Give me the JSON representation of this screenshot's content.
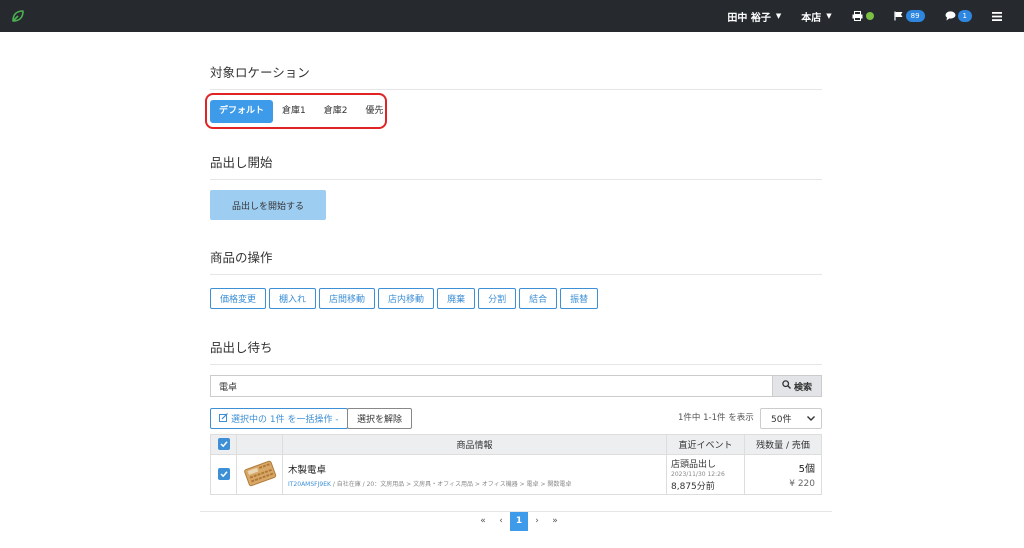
{
  "navbar": {
    "logo_icon": "leaf-icon",
    "user_name": "田中 裕子",
    "store_name": "本店",
    "printer_icon": "printer-icon",
    "flag_count": "89",
    "message_count": "1",
    "menu_icon": "hamburger-icon"
  },
  "location": {
    "title": "対象ロケーション",
    "tabs": [
      "デフォルト",
      "倉庫1",
      "倉庫2",
      "優先"
    ],
    "active_index": 0
  },
  "start": {
    "title": "品出し開始",
    "button": "品出しを開始する"
  },
  "operations": {
    "title": "商品の操作",
    "buttons": [
      "価格変更",
      "棚入れ",
      "店間移動",
      "店内移動",
      "廃棄",
      "分割",
      "結合",
      "振替"
    ]
  },
  "waiting": {
    "title": "品出し待ち",
    "search_value": "電卓",
    "search_button": "検索",
    "bulk_button": "選択中の 1件 を一括操作 -",
    "clear_button": "選択を解除",
    "count_text": "1件中 1-1件 を表示",
    "per_page": "50件",
    "columns": [
      "商品情報",
      "直近イベント",
      "残数量 / 売価"
    ],
    "rows": [
      {
        "name": "木製電卓",
        "code": "IT20AMSFJ9EK",
        "path": " / 自社在庫 / 20：文房用品 > 文房具・オフィス用品 > オフィス機器 > 電卓 > 関数電卓",
        "event": "店頭品出し",
        "event_date": "2023/11/30 12:26",
        "event_ago": "8,875分前",
        "stock": "5個",
        "price": "¥ 220"
      }
    ],
    "pager": [
      "«",
      "‹",
      "1",
      "›",
      "»"
    ],
    "current_page": "1"
  },
  "colors": {
    "navbar_bg": "#262a2f",
    "accent": "#3d9be9",
    "highlight_box": "#e02424",
    "online_dot": "#7bc043"
  }
}
